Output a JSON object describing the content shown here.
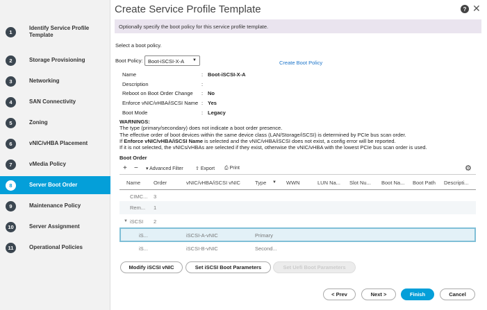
{
  "sidebar": {
    "steps": [
      {
        "num": "1",
        "label": "Identify Service Profile Template"
      },
      {
        "num": "2",
        "label": "Storage Provisioning"
      },
      {
        "num": "3",
        "label": "Networking"
      },
      {
        "num": "4",
        "label": "SAN Connectivity"
      },
      {
        "num": "5",
        "label": "Zoning"
      },
      {
        "num": "6",
        "label": "vNIC/vHBA Placement"
      },
      {
        "num": "7",
        "label": "vMedia Policy"
      },
      {
        "num": "8",
        "label": "Server Boot Order"
      },
      {
        "num": "9",
        "label": "Maintenance Policy"
      },
      {
        "num": "10",
        "label": "Server Assignment"
      },
      {
        "num": "11",
        "label": "Operational Policies"
      }
    ],
    "active": "Server Boot Order"
  },
  "header": {
    "title": "Create Service Profile Template",
    "help": "?",
    "close": "✕",
    "banner": "Optionally specify the boot policy for this service profile template."
  },
  "boot": {
    "prompt": "Select a boot policy.",
    "policy_label": "Boot Policy:",
    "policy_value": "Boot-iSCSI-X-A",
    "create_link": "Create Boot Policy",
    "details": [
      {
        "k": "Name",
        "sep": ":",
        "v": "Boot-iSCSI-X-A"
      },
      {
        "k": "Description",
        "sep": ":",
        "v": ""
      },
      {
        "k": "Reboot on Boot Order Change",
        "sep": ":",
        "v": "No"
      },
      {
        "k": "Enforce vNIC/vHBA/iSCSI Name",
        "sep": ":",
        "v": "Yes"
      },
      {
        "k": "Boot Mode",
        "sep": ":",
        "v": "Legacy"
      }
    ]
  },
  "warnings": {
    "title": "WARNINGS:",
    "line1": "The type (primary/secondary) does not indicate a boot order presence.",
    "line2": "The effective order of boot devices within the same device class (LAN/Storage/iSCSI) is determined by PCIe bus scan order.",
    "line3_pre": "If ",
    "line3_bold": "Enforce vNIC/vHBA/iSCSI Name",
    "line3_post": " is selected and the vNIC/vHBA/iSCSI does not exist, a config error will be reported.",
    "line4": "If it is not selected, the vNICs/vHBAs are selected if they exist, otherwise the vNIC/vHBA with the lowest PCIe bus scan order is used."
  },
  "boot_order": {
    "title": "Boot Order",
    "toolbar": {
      "add": "+",
      "remove": "−",
      "filter": "Advanced Filter",
      "export": "Export",
      "print": "Print"
    },
    "columns": [
      "Name",
      "Order",
      "vNIC/vHBA/iSCSI vNIC",
      "Type",
      "WWN",
      "LUN Na...",
      "Slot Nu...",
      "Boot Na...",
      "Boot Path",
      "Descripti..."
    ],
    "rows": [
      {
        "name": "CIMC...",
        "order": "3",
        "vnic": "",
        "type": ""
      },
      {
        "name": "Rem...",
        "order": "1",
        "vnic": "",
        "type": ""
      },
      {
        "name": "iSCSI",
        "order": "2",
        "vnic": "",
        "type": ""
      },
      {
        "name": "iS...",
        "order": "",
        "vnic": "iSCSI-A-vNIC",
        "type": "Primary"
      },
      {
        "name": "iS...",
        "order": "",
        "vnic": "iSCSI-B-vNIC",
        "type": "Second..."
      }
    ]
  },
  "actions": {
    "modify": "Modify iSCSI vNIC",
    "set_params": "Set iSCSI Boot Parameters",
    "set_uefi": "Set Uefi Boot Parameters"
  },
  "footer": {
    "prev": "< Prev",
    "next": "Next >",
    "finish": "Finish",
    "cancel": "Cancel"
  },
  "colors": {
    "accent": "#049fd9",
    "banner": "#eae4ef"
  }
}
